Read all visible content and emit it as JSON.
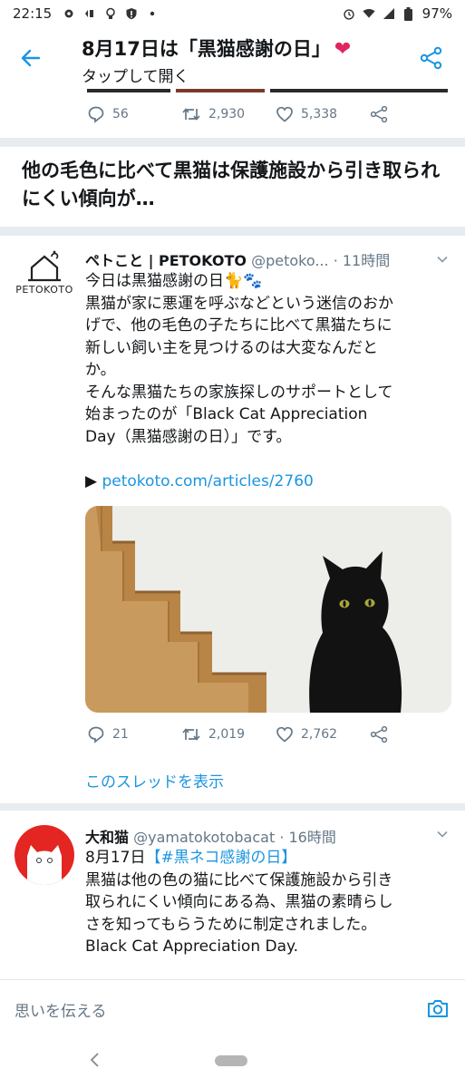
{
  "status_bar": {
    "time": "22:15",
    "battery": "97%",
    "icons": [
      "settings-icon",
      "vibrate-icon",
      "bulb-icon",
      "shield-icon",
      "dot-icon",
      "alarm-icon",
      "wifi-icon",
      "signal-icon",
      "battery-icon"
    ]
  },
  "header": {
    "title": "8月17日は「黒猫感謝の日」",
    "title_emoji": "❤",
    "subtitle": "タップして開く"
  },
  "top_tweet_actions": {
    "replies": "56",
    "retweets": "2,930",
    "likes": "5,338"
  },
  "headline": {
    "text": "他の毛色に比べて黒猫は保護施設から引き取られにくい傾向が…"
  },
  "tweet1": {
    "avatar_label": "PETOKOTO",
    "name": "ペトこと | PETOKOTO",
    "handle": "@petoko...",
    "time": "· 11時間",
    "lines": [
      "今日は黒猫感謝の日🐈🐾",
      "黒猫が家に悪運を呼ぶなどという迷信のおか",
      "げで、他の毛色の子たちに比べて黒猫たちに",
      "新しい飼い主を見つけるのは大変なんだと",
      "か。",
      "そんな黒猫たちの家族探しのサポートとして",
      "始まったのが「Black Cat Appreciation",
      "Day（黒猫感謝の日）」です。"
    ],
    "link_prefix": "▶ ",
    "link": "petokoto.com/articles/2760",
    "replies": "21",
    "retweets": "2,019",
    "likes": "2,762",
    "show_thread": "このスレッドを表示"
  },
  "tweet2": {
    "name": "大和猫",
    "handle": "@yamatokotobacat",
    "time": "· 16時間",
    "date_prefix": "8月17日",
    "hashtag": "【#黒ネコ感謝の日】",
    "lines": [
      "黒猫は他の色の猫に比べて保護施設から引き",
      "取られにくい傾向にある為、黒猫の素晴らし",
      "さを知ってもらうために制定されました。",
      "Black Cat Appreciation Day."
    ]
  },
  "reply_bar": {
    "placeholder": "思いを伝える"
  },
  "colors": {
    "accent": "#1b95e0",
    "heart": "#e0245e",
    "muted": "#657786",
    "divider": "#e6ecf0"
  }
}
